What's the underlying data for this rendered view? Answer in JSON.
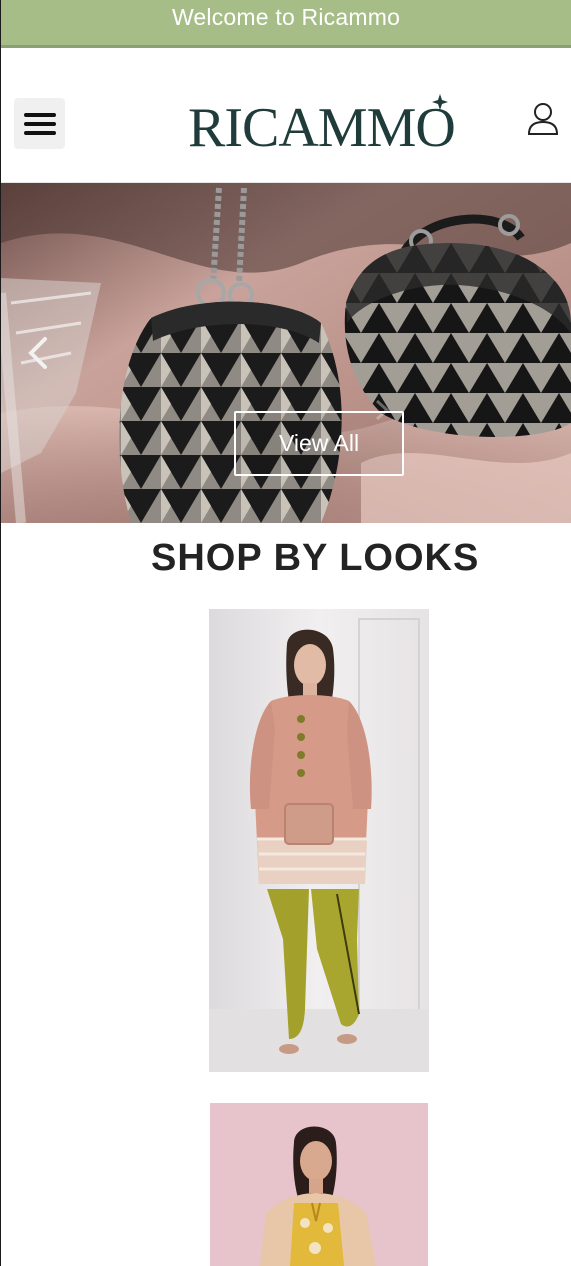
{
  "announcement": {
    "text": "Welcome to Ricammo"
  },
  "header": {
    "logo_text": "RICAMMO",
    "menu_icon": "hamburger-menu-icon",
    "account_icon": "user-icon"
  },
  "hero": {
    "button_label": "View All",
    "prev_icon": "chevron-left-icon",
    "next_icon": "chevron-right-icon"
  },
  "section": {
    "title": "SHOP BY LOOKS"
  },
  "looks": [
    {
      "image": "look-photo-blush-kurta"
    },
    {
      "image": "look-photo-yellow-embroidered"
    }
  ],
  "colors": {
    "announcement_bg": "#a6bd88",
    "logo": "#1f3b3a",
    "title": "#232323"
  }
}
